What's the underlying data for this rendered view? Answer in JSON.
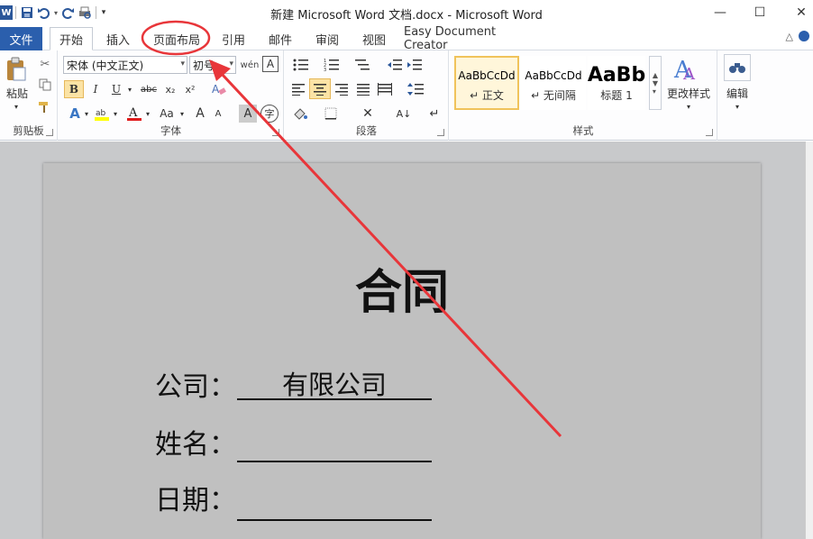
{
  "app": {
    "title": "新建 Microsoft Word 文档.docx - Microsoft Word",
    "qat": {
      "logo": "W",
      "customize": "▾"
    }
  },
  "window_controls": {
    "minimize": "—",
    "maximize": "☐",
    "close": "✕"
  },
  "tabs": {
    "file": "文件",
    "items": [
      "开始",
      "插入",
      "页面布局",
      "引用",
      "邮件",
      "审阅",
      "视图",
      "Easy Document Creator"
    ],
    "active": "开始"
  },
  "ribbon": {
    "clipboard": {
      "label": "剪贴板",
      "paste": "粘贴"
    },
    "font": {
      "label": "字体",
      "font_name": "宋体 (中文正文)",
      "font_size": "初号",
      "bold": "B",
      "italic": "I",
      "underline": "U",
      "strike": "abc",
      "sub": "x₂",
      "sup": "x²",
      "grow": "A",
      "shrink": "A",
      "case": "Aa",
      "wen": "wén",
      "border_a": "A",
      "circle_char": "字"
    },
    "paragraph": {
      "label": "段落"
    },
    "styles": {
      "label": "样式",
      "items": [
        {
          "sample": "AaBbCcDd",
          "name": "↵ 正文"
        },
        {
          "sample": "AaBbCcDd",
          "name": "↵ 无间隔"
        },
        {
          "sample": "AaBb",
          "name": "标题 1"
        }
      ],
      "change_styles": "更改样式"
    },
    "editing": {
      "label": "编辑"
    }
  },
  "document": {
    "title": "合同",
    "fields": [
      {
        "label": "公司：",
        "value": "有限公司"
      },
      {
        "label": "姓名：",
        "value": ""
      },
      {
        "label": "日期：",
        "value": ""
      }
    ]
  },
  "colors": {
    "accent": "#2b5fad",
    "annotation": "#e8363a",
    "page_background": "#c0c0c0",
    "style_highlight": "#f0c35b"
  }
}
